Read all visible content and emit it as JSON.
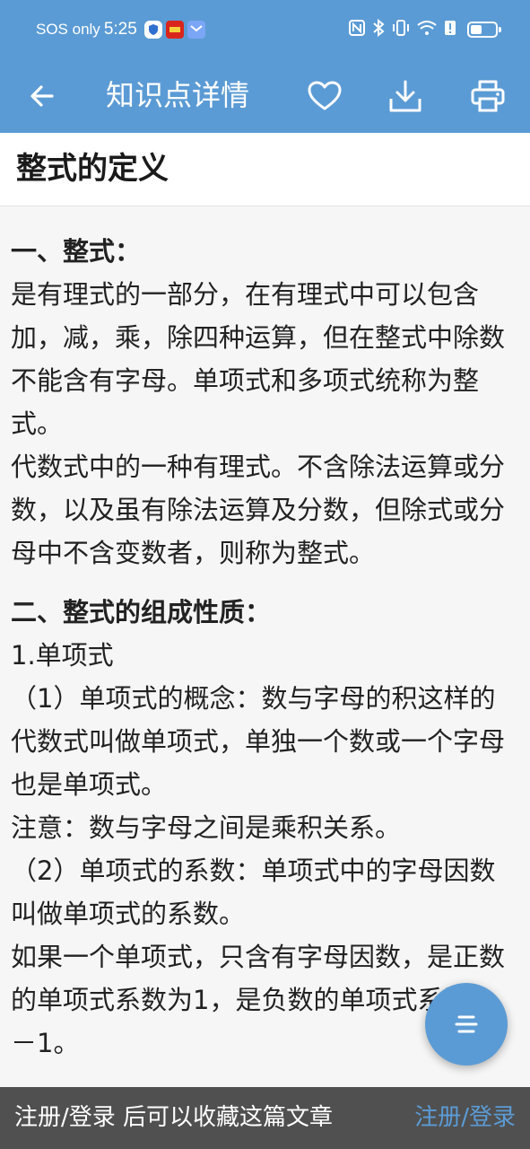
{
  "status_bar": {
    "carrier": "SOS only",
    "time": "5:25",
    "icons": [
      "shield-icon",
      "app-badge-icon",
      "mail-app-icon",
      "nfc-icon",
      "bluetooth-icon",
      "vibrate-icon",
      "wifi-icon",
      "alert-icon",
      "battery-icon"
    ]
  },
  "app_bar": {
    "title": "知识点详情",
    "icons": [
      "back-arrow-icon",
      "heart-icon",
      "download-icon",
      "print-icon"
    ]
  },
  "article": {
    "title": "整式的定义",
    "section1_heading": "一、整式：",
    "section1_para1": "是有理式的一部分，在有理式中可以包含加，减，乘，除四种运算，但在整式中除数不能含有字母。单项式和多项式统称为整式。",
    "section1_para2": "代数式中的一种有理式。不含除法运算或分数，以及虽有除法运算及分数，但除式或分母中不含变数者，则称为整式。",
    "section2_heading": "二、整式的组成性质：",
    "item1_title": "1.单项式",
    "item1_point1": "（1）单项式的概念：数与字母的积这样的代数式叫做单项式，单独一个数或一个字母也是单项式。",
    "item1_note": "注意：数与字母之间是乘积关系。",
    "item1_point2": "（2）单项式的系数：单项式中的字母因数叫做单项式的系数。",
    "item1_point3": "如果一个单项式，只含有字母因数，是正数的单项式系数为1，是负数的单项式系数为－1。"
  },
  "fab": {
    "icon": "menu-icon"
  },
  "bottom_bar": {
    "message": "注册/登录 后可以收藏这篇文章",
    "login_link": "注册/登录"
  },
  "colors": {
    "primary": "#5b9bd5",
    "bottom_bar_bg": "#505050",
    "content_bg": "#f6f6f6"
  }
}
